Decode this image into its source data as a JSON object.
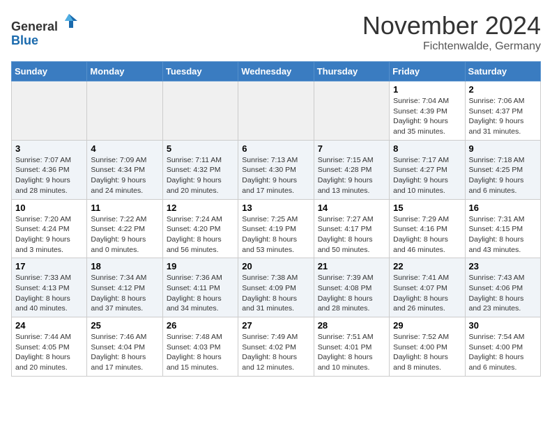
{
  "header": {
    "logo_general": "General",
    "logo_blue": "Blue",
    "month_title": "November 2024",
    "subtitle": "Fichtenwalde, Germany"
  },
  "days_of_week": [
    "Sunday",
    "Monday",
    "Tuesday",
    "Wednesday",
    "Thursday",
    "Friday",
    "Saturday"
  ],
  "weeks": [
    [
      {
        "day": "",
        "info": ""
      },
      {
        "day": "",
        "info": ""
      },
      {
        "day": "",
        "info": ""
      },
      {
        "day": "",
        "info": ""
      },
      {
        "day": "",
        "info": ""
      },
      {
        "day": "1",
        "info": "Sunrise: 7:04 AM\nSunset: 4:39 PM\nDaylight: 9 hours and 35 minutes."
      },
      {
        "day": "2",
        "info": "Sunrise: 7:06 AM\nSunset: 4:37 PM\nDaylight: 9 hours and 31 minutes."
      }
    ],
    [
      {
        "day": "3",
        "info": "Sunrise: 7:07 AM\nSunset: 4:36 PM\nDaylight: 9 hours and 28 minutes."
      },
      {
        "day": "4",
        "info": "Sunrise: 7:09 AM\nSunset: 4:34 PM\nDaylight: 9 hours and 24 minutes."
      },
      {
        "day": "5",
        "info": "Sunrise: 7:11 AM\nSunset: 4:32 PM\nDaylight: 9 hours and 20 minutes."
      },
      {
        "day": "6",
        "info": "Sunrise: 7:13 AM\nSunset: 4:30 PM\nDaylight: 9 hours and 17 minutes."
      },
      {
        "day": "7",
        "info": "Sunrise: 7:15 AM\nSunset: 4:28 PM\nDaylight: 9 hours and 13 minutes."
      },
      {
        "day": "8",
        "info": "Sunrise: 7:17 AM\nSunset: 4:27 PM\nDaylight: 9 hours and 10 minutes."
      },
      {
        "day": "9",
        "info": "Sunrise: 7:18 AM\nSunset: 4:25 PM\nDaylight: 9 hours and 6 minutes."
      }
    ],
    [
      {
        "day": "10",
        "info": "Sunrise: 7:20 AM\nSunset: 4:24 PM\nDaylight: 9 hours and 3 minutes."
      },
      {
        "day": "11",
        "info": "Sunrise: 7:22 AM\nSunset: 4:22 PM\nDaylight: 9 hours and 0 minutes."
      },
      {
        "day": "12",
        "info": "Sunrise: 7:24 AM\nSunset: 4:20 PM\nDaylight: 8 hours and 56 minutes."
      },
      {
        "day": "13",
        "info": "Sunrise: 7:25 AM\nSunset: 4:19 PM\nDaylight: 8 hours and 53 minutes."
      },
      {
        "day": "14",
        "info": "Sunrise: 7:27 AM\nSunset: 4:17 PM\nDaylight: 8 hours and 50 minutes."
      },
      {
        "day": "15",
        "info": "Sunrise: 7:29 AM\nSunset: 4:16 PM\nDaylight: 8 hours and 46 minutes."
      },
      {
        "day": "16",
        "info": "Sunrise: 7:31 AM\nSunset: 4:15 PM\nDaylight: 8 hours and 43 minutes."
      }
    ],
    [
      {
        "day": "17",
        "info": "Sunrise: 7:33 AM\nSunset: 4:13 PM\nDaylight: 8 hours and 40 minutes."
      },
      {
        "day": "18",
        "info": "Sunrise: 7:34 AM\nSunset: 4:12 PM\nDaylight: 8 hours and 37 minutes."
      },
      {
        "day": "19",
        "info": "Sunrise: 7:36 AM\nSunset: 4:11 PM\nDaylight: 8 hours and 34 minutes."
      },
      {
        "day": "20",
        "info": "Sunrise: 7:38 AM\nSunset: 4:09 PM\nDaylight: 8 hours and 31 minutes."
      },
      {
        "day": "21",
        "info": "Sunrise: 7:39 AM\nSunset: 4:08 PM\nDaylight: 8 hours and 28 minutes."
      },
      {
        "day": "22",
        "info": "Sunrise: 7:41 AM\nSunset: 4:07 PM\nDaylight: 8 hours and 26 minutes."
      },
      {
        "day": "23",
        "info": "Sunrise: 7:43 AM\nSunset: 4:06 PM\nDaylight: 8 hours and 23 minutes."
      }
    ],
    [
      {
        "day": "24",
        "info": "Sunrise: 7:44 AM\nSunset: 4:05 PM\nDaylight: 8 hours and 20 minutes."
      },
      {
        "day": "25",
        "info": "Sunrise: 7:46 AM\nSunset: 4:04 PM\nDaylight: 8 hours and 17 minutes."
      },
      {
        "day": "26",
        "info": "Sunrise: 7:48 AM\nSunset: 4:03 PM\nDaylight: 8 hours and 15 minutes."
      },
      {
        "day": "27",
        "info": "Sunrise: 7:49 AM\nSunset: 4:02 PM\nDaylight: 8 hours and 12 minutes."
      },
      {
        "day": "28",
        "info": "Sunrise: 7:51 AM\nSunset: 4:01 PM\nDaylight: 8 hours and 10 minutes."
      },
      {
        "day": "29",
        "info": "Sunrise: 7:52 AM\nSunset: 4:00 PM\nDaylight: 8 hours and 8 minutes."
      },
      {
        "day": "30",
        "info": "Sunrise: 7:54 AM\nSunset: 4:00 PM\nDaylight: 8 hours and 6 minutes."
      }
    ]
  ]
}
